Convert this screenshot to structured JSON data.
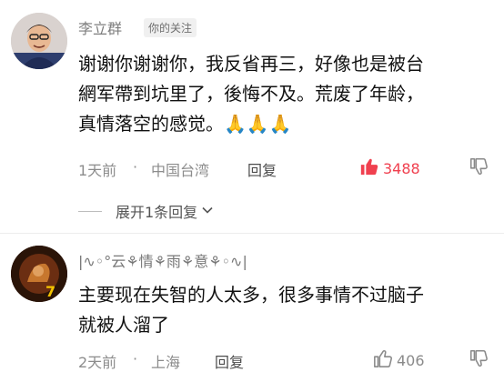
{
  "comments": [
    {
      "author": "李立群",
      "badge": "你的关注",
      "lines": [
        "谢谢你谢谢你，我反省再三，好像也是被台",
        "網军帶到坑里了，後悔不及。荒废了年龄，",
        "真情落空的感觉。🙏🙏🙏"
      ],
      "time": "1天前",
      "location": "中国台湾",
      "reply": "回复",
      "likes": "3488"
    },
    {
      "author": "|∿◦°云⚘情⚘雨⚘意⚘◦∿|",
      "lines": [
        "主要现在失智的人太多，很多事情不过脑子",
        "就被人溜了"
      ],
      "time": "2天前",
      "location": "上海",
      "reply": "回复",
      "likes": "406"
    }
  ],
  "expand_replies": "展开1条回复",
  "separator": "·",
  "colors": {
    "like_active": "#f0404f",
    "muted": "#8c8c8c"
  }
}
